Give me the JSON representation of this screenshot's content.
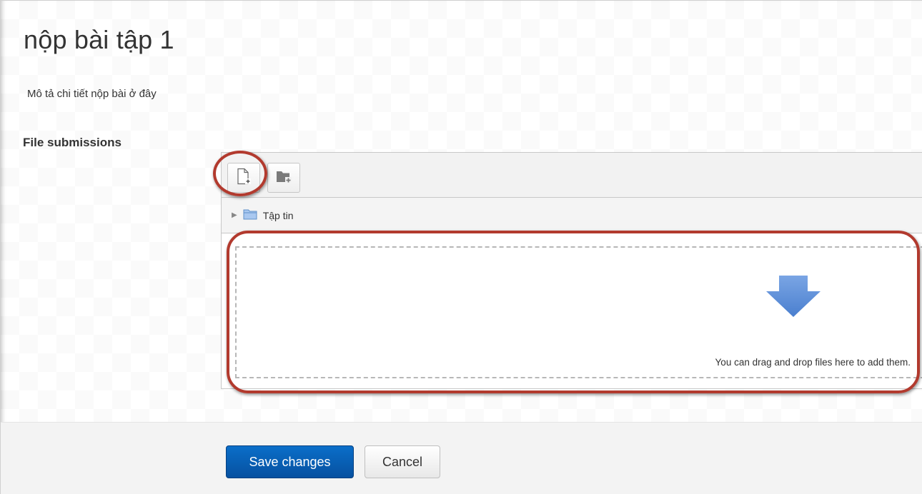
{
  "page": {
    "title": "nộp bài tập 1",
    "description": "Mô tả chi tiết nộp bài ở đây"
  },
  "file_submissions": {
    "label": "File submissions",
    "toolbar": {
      "add_file_icon": "add-file-icon",
      "create_folder_icon": "create-folder-icon"
    },
    "path": {
      "folder_name": "Tập tin"
    },
    "dropzone": {
      "message": "You can drag and drop files here to add them."
    }
  },
  "actions": {
    "save_label": "Save changes",
    "cancel_label": "Cancel"
  },
  "colors": {
    "primary_button": "#0a6ec9",
    "highlight_circle": "#b23a2e",
    "drop_arrow": "#5b8fd6"
  }
}
